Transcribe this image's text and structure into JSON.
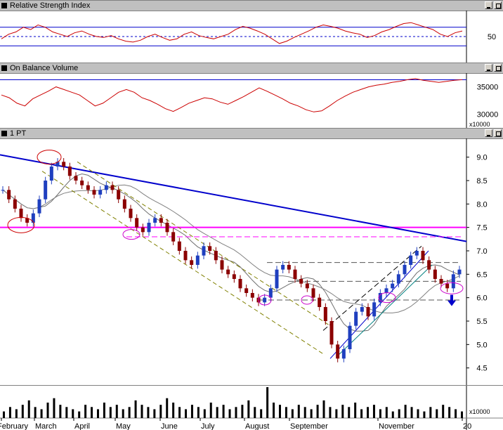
{
  "window": {
    "rsi_title": "Relative Strength Index",
    "obv_title": "On Balance Volume",
    "price_title": "1 PT"
  },
  "rsi_axis": {
    "label": "50"
  },
  "obv_axis": {
    "labels": [
      "35000",
      "30000"
    ],
    "multiplier": "x10000"
  },
  "price_axis": {
    "labels": [
      "9.0",
      "8.5",
      "8.0",
      "7.5",
      "7.0",
      "6.5",
      "6.0",
      "5.5",
      "5.0",
      "4.5"
    ]
  },
  "volume_axis": {
    "multiplier": "x10000"
  },
  "months": [
    "February",
    "March",
    "April",
    "May",
    "June",
    "July",
    "August",
    "September",
    "November",
    "20"
  ],
  "colors": {
    "price_up": "#1f3fbf",
    "price_down": "#8b0000",
    "indicator": "#cc0000",
    "trendline": "#0000cc",
    "resistance": "#ff00ff"
  },
  "chart_data": [
    {
      "type": "line",
      "title": "Relative Strength Index",
      "ylim": [
        0,
        100
      ],
      "reference_lines": [
        30,
        50,
        70
      ],
      "tick_labels": [
        "50"
      ],
      "series": [
        {
          "values": [
            45,
            55,
            60,
            70,
            65,
            75,
            70,
            60,
            55,
            50,
            58,
            62,
            55,
            50,
            48,
            52,
            45,
            40,
            38,
            42,
            50,
            55,
            48,
            42,
            45,
            55,
            60,
            52,
            48,
            45,
            50,
            55,
            65,
            72,
            68,
            62,
            55,
            45,
            35,
            40,
            48,
            55,
            62,
            70,
            75,
            72,
            68,
            62,
            58,
            55,
            48,
            52,
            60,
            65,
            72,
            78,
            80,
            75,
            70,
            65,
            55,
            50,
            58,
            62
          ]
        }
      ]
    },
    {
      "type": "line",
      "title": "On Balance Volume",
      "ylim": [
        28000,
        37000
      ],
      "tick_labels": [
        "35000",
        "30000"
      ],
      "series": [
        {
          "values": [
            33500,
            33000,
            32000,
            31500,
            32800,
            33500,
            34200,
            35000,
            34500,
            34000,
            33500,
            32500,
            31500,
            32000,
            33000,
            34000,
            34500,
            34000,
            33000,
            32500,
            31800,
            31000,
            30500,
            31200,
            32000,
            32500,
            33000,
            32800,
            32200,
            31800,
            32500,
            33200,
            34000,
            34800,
            34200,
            33500,
            32800,
            32000,
            31500,
            30800,
            30400,
            30600,
            31500,
            32500,
            33300,
            34000,
            34500,
            35000,
            35300,
            35500,
            35800,
            36000,
            36300,
            36500,
            36200,
            36000,
            35800,
            36000,
            36200,
            36300
          ]
        }
      ]
    },
    {
      "type": "candlestick",
      "title": "1 PT",
      "ylim": [
        4.3,
        9.25
      ],
      "tick_labels": [
        "9.0",
        "8.5",
        "8.0",
        "7.5",
        "7.0",
        "6.5",
        "6.0",
        "5.5",
        "5.0",
        "4.5"
      ],
      "x_labels": [
        "February",
        "March",
        "April",
        "May",
        "June",
        "July",
        "August",
        "September",
        "November",
        "20"
      ],
      "close": [
        8.3,
        8.1,
        7.9,
        7.7,
        7.6,
        7.8,
        8.1,
        8.5,
        8.8,
        8.9,
        8.8,
        8.6,
        8.5,
        8.4,
        8.3,
        8.2,
        8.3,
        8.4,
        8.3,
        8.1,
        7.9,
        7.7,
        7.5,
        7.4,
        7.6,
        7.7,
        7.6,
        7.4,
        7.2,
        7.0,
        6.8,
        6.7,
        6.9,
        7.1,
        7.0,
        6.8,
        6.6,
        6.5,
        6.4,
        6.2,
        6.1,
        6.0,
        5.9,
        6.0,
        6.2,
        6.6,
        6.7,
        6.6,
        6.4,
        6.3,
        6.2,
        6.0,
        5.8,
        5.5,
        5.0,
        4.7,
        4.9,
        5.4,
        5.7,
        5.8,
        5.6,
        5.9,
        6.1,
        6.2,
        6.3,
        6.5,
        6.7,
        6.9,
        7.0,
        6.8,
        6.6,
        6.4,
        6.3,
        6.2,
        6.5,
        6.6
      ],
      "annotations": {
        "downtrend_line": [
          9.05,
          7.2
        ],
        "resistance_level": 7.5,
        "dashed_levels": [
          7.3,
          6.75,
          6.35,
          5.95
        ]
      }
    },
    {
      "type": "bar",
      "title": "Volume",
      "values": [
        3,
        5,
        4,
        6,
        8,
        5,
        4,
        7,
        9,
        6,
        5,
        4,
        3,
        6,
        5,
        4,
        7,
        5,
        6,
        4,
        5,
        8,
        6,
        5,
        4,
        6,
        9,
        7,
        5,
        4,
        6,
        5,
        4,
        7,
        5,
        6,
        4,
        5,
        6,
        8,
        5,
        4,
        14,
        7,
        6,
        5,
        4,
        6,
        5,
        4,
        6,
        8,
        5,
        4,
        6,
        5,
        7,
        4,
        5,
        6,
        4,
        5,
        3,
        4,
        6,
        5,
        4,
        3,
        5,
        4,
        6,
        5,
        4,
        3
      ]
    }
  ]
}
